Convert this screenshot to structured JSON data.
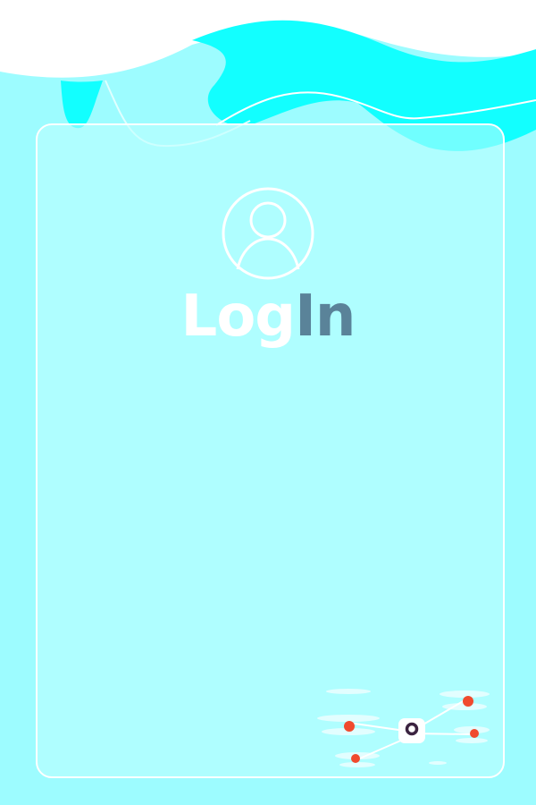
{
  "title": {
    "part1": "Log",
    "part2": "In"
  },
  "colors": {
    "background": "#9dfcff",
    "wave": "#12ffff",
    "card_border": "#ffffff",
    "title_accent": "#5a8399",
    "drone_markers": "#f04a2e"
  },
  "icons": {
    "avatar": "user-circle-icon",
    "illustration": "drone-illustration"
  }
}
